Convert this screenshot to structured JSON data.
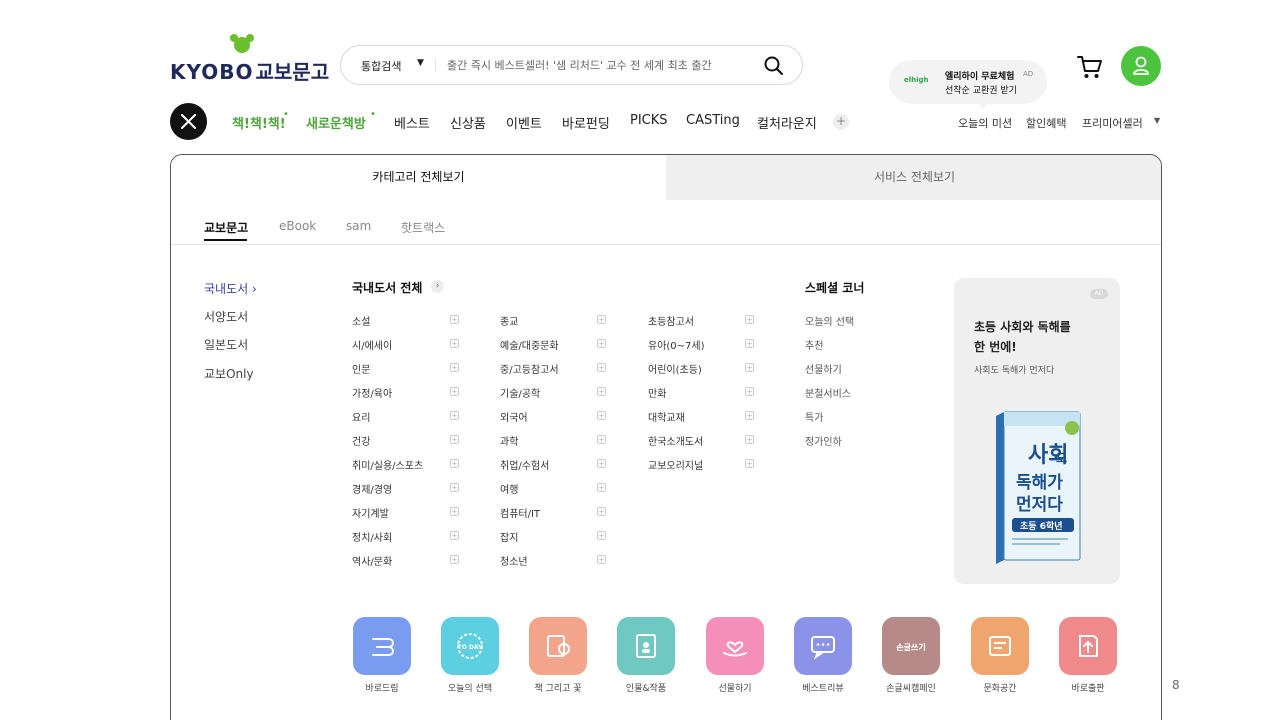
{
  "header": {
    "logo_text": "KYOBO",
    "logo_text_ko": "교보문고",
    "search": {
      "scope": "통합검색",
      "placeholder": "출간 즉시 베스트셀러! '샘 리처드' 교수 전 세계 최초 출간"
    },
    "ad_bubble": {
      "brand": "elhigh",
      "line1": "엘리하이 무료체험",
      "ad_mark": "AD",
      "line2": "선착순 교환권 받기"
    }
  },
  "nav": {
    "items": [
      {
        "label": "책!책!책!",
        "highlight": true
      },
      {
        "label": "새로운책방",
        "highlight": true
      },
      {
        "label": "베스트",
        "highlight": false
      },
      {
        "label": "신상품",
        "highlight": false
      },
      {
        "label": "이벤트",
        "highlight": false
      },
      {
        "label": "바로펀딩",
        "highlight": false
      },
      {
        "label": "PICKS",
        "highlight": false
      },
      {
        "label": "CASTing",
        "highlight": false
      },
      {
        "label": "컬처라운지",
        "highlight": false
      }
    ],
    "utility": [
      "오늘의 미션",
      "할인혜택",
      "프리미어셀러"
    ]
  },
  "panel": {
    "tabs": [
      "카테고리 전체보기",
      "서비스 전체보기"
    ],
    "subtabs": [
      "교보문고",
      "eBook",
      "sam",
      "핫트랙스"
    ],
    "left_categories": [
      "국내도서",
      "서양도서",
      "일본도서",
      "교보Only"
    ],
    "section_title": "국내도서 전체",
    "columns": [
      [
        "소설",
        "시/에세이",
        "인문",
        "가정/육아",
        "요리",
        "건강",
        "취미/실용/스포츠",
        "경제/경영",
        "자기계발",
        "정치/사회",
        "역사/문화"
      ],
      [
        "종교",
        "예술/대중문화",
        "중/고등참고서",
        "기술/공학",
        "외국어",
        "과학",
        "취업/수험서",
        "여행",
        "컴퓨터/IT",
        "잡지",
        "청소년"
      ],
      [
        "초등참고서",
        "유아(0~7세)",
        "어린이(초등)",
        "만화",
        "대학교재",
        "한국소개도서",
        "교보오리지널"
      ]
    ],
    "special": {
      "title": "스페셜 코너",
      "items": [
        "오늘의 선택",
        "추천",
        "선물하기",
        "분철서비스",
        "특가",
        "정가인하"
      ]
    },
    "ad_card": {
      "tag": "AD",
      "line1": "초등 사회와 독해를",
      "line2": "한 번에!",
      "line3": "사회도 독해가 먼저다",
      "book_title_1": "사회",
      "book_title_1b": "도",
      "book_title_2": "독해가",
      "book_title_3": "먼저다",
      "book_grade": "초등 6학년"
    },
    "quick_links": [
      {
        "label": "바로드림",
        "color": "#7a9cf0",
        "icon": "barodream-icon"
      },
      {
        "label": "오늘의 선택",
        "color": "#5ccfe0",
        "icon": "today-badge-icon",
        "badge": "TO DAY"
      },
      {
        "label": "책 그리고 꽃",
        "color": "#f3a58c",
        "icon": "book-flower-icon"
      },
      {
        "label": "인물&작품",
        "color": "#6fc8c2",
        "icon": "portrait-icon"
      },
      {
        "label": "선물하기",
        "color": "#f58fb9",
        "icon": "gift-heart-icon"
      },
      {
        "label": "베스트리뷰",
        "color": "#8b93e8",
        "icon": "review-chat-icon"
      },
      {
        "label": "손글씨캠페인",
        "color": "#b58a88",
        "icon": "handwriting-icon",
        "badge": "손글쓰기"
      },
      {
        "label": "문화공간",
        "color": "#f0a46e",
        "icon": "culture-space-icon"
      },
      {
        "label": "바로출판",
        "color": "#f08a8a",
        "icon": "publish-icon"
      }
    ]
  },
  "page_number": "8"
}
